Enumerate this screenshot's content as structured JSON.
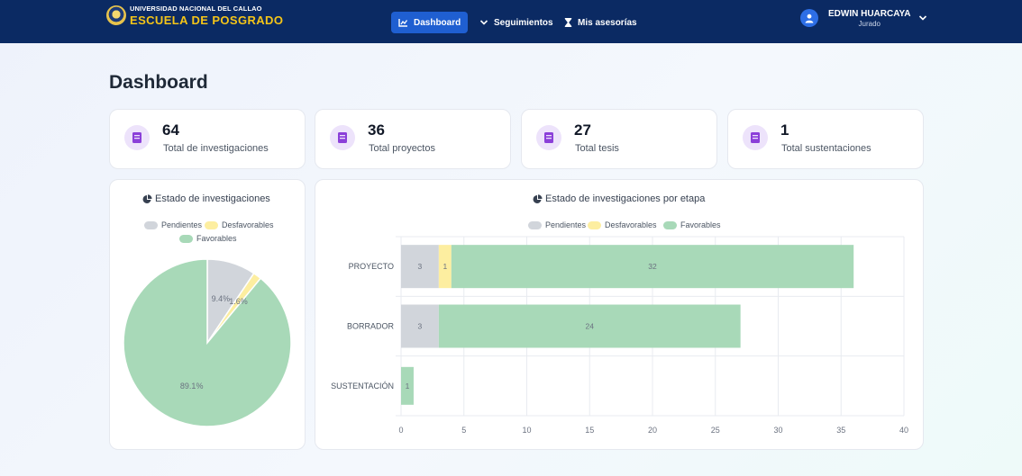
{
  "nav": {
    "brand_top": "UNIVERSIDAD NACIONAL DEL CALLAO",
    "brand_bottom": "ESCUELA DE POSGRADO",
    "items": [
      {
        "label": "Dashboard",
        "icon": "chart-line-icon",
        "active": true
      },
      {
        "label": "Seguimientos",
        "icon": "chevron-down-icon",
        "active": false
      },
      {
        "label": "Mis asesorías",
        "icon": "hourglass-icon",
        "active": false
      }
    ],
    "user": {
      "name": "EDWIN HUARCAYA",
      "role": "Jurado"
    }
  },
  "page": {
    "title": "Dashboard"
  },
  "stats": [
    {
      "value": "64",
      "label": "Total de investigaciones",
      "icon": "book-icon"
    },
    {
      "value": "36",
      "label": "Total proyectos",
      "icon": "book-icon"
    },
    {
      "value": "27",
      "label": "Total tesis",
      "icon": "book-icon"
    },
    {
      "value": "1",
      "label": "Total sustentaciones",
      "icon": "book-icon"
    }
  ],
  "colors": {
    "nav_bg": "#0b2a63",
    "active": "#1f5fd1",
    "pendientes": "#d1d5db",
    "desfavorables": "#fdeea0",
    "favorables": "#a8d9b8",
    "stat_icon_bg": "#ede3fb",
    "stat_icon": "#8b3fd9"
  },
  "chart_data": [
    {
      "type": "pie",
      "title": "Estado de investigaciones",
      "legend": [
        "Pendientes",
        "Desfavorables",
        "Favorables"
      ],
      "labels": [
        "Pendientes",
        "Desfavorables",
        "Favorables"
      ],
      "values": [
        9.4,
        1.6,
        89.1
      ],
      "value_labels": [
        "9.4%",
        "1.6%",
        "89.1%"
      ],
      "legend_placement": "top"
    },
    {
      "type": "bar",
      "orientation": "horizontal",
      "stacked": true,
      "title": "Estado de investigaciones por etapa",
      "categories": [
        "PROYECTO",
        "BORRADOR",
        "SUSTENTACIÓN"
      ],
      "series": [
        {
          "name": "Pendientes",
          "values": [
            3,
            3,
            0
          ]
        },
        {
          "name": "Desfavorables",
          "values": [
            1,
            0,
            0
          ]
        },
        {
          "name": "Favorables",
          "values": [
            32,
            24,
            1
          ]
        }
      ],
      "xlim": [
        0,
        40
      ],
      "xticks": [
        0,
        5,
        10,
        15,
        20,
        25,
        30,
        35,
        40
      ],
      "grid": true,
      "legend_placement": "top"
    }
  ]
}
